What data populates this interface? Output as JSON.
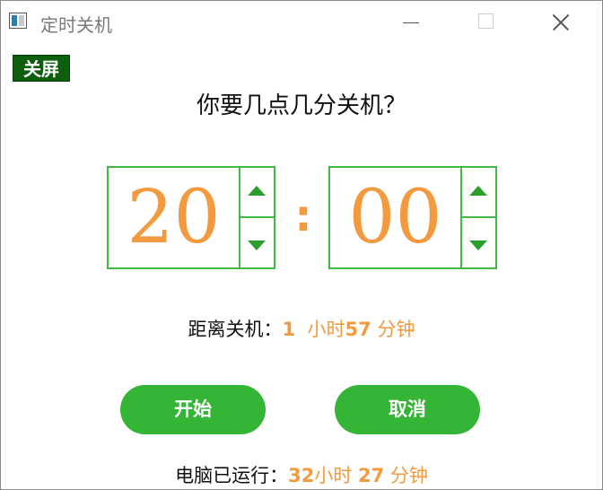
{
  "window": {
    "title": "定时关机",
    "controls": {
      "minimize": "minimize-icon",
      "maximize": "maximize-icon",
      "close": "close-icon"
    }
  },
  "toolbar": {
    "screen_off_label": "关屏"
  },
  "main": {
    "question": "你要几点几分关机？",
    "hours": "20",
    "separator": ":",
    "minutes": "00",
    "remaining": {
      "label": "距离关机：",
      "hours": "1",
      "hours_unit": "小时",
      "minutes": "57",
      "minutes_unit": "分钟"
    },
    "start_label": "开始",
    "cancel_label": "取消",
    "uptime": {
      "label": "电脑已运行：",
      "hours": "32",
      "hours_unit": "小时",
      "minutes": "27",
      "minutes_unit": "分钟"
    }
  },
  "colors": {
    "accent_green": "#35b535",
    "border_green": "#44b844",
    "number_orange": "#f39a3e",
    "screen_off_bg": "#0d5f0d"
  }
}
